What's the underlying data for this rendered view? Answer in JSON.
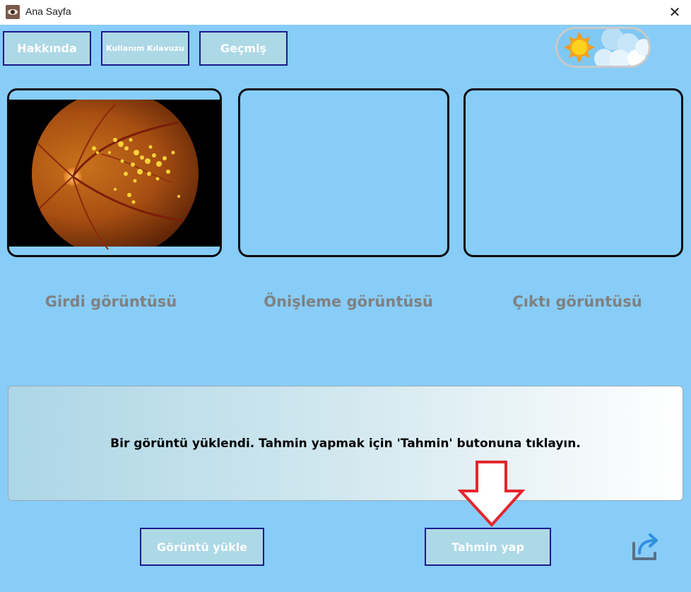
{
  "window": {
    "title": "Ana Sayfa",
    "close_glyph": "✕"
  },
  "toolbar": {
    "about_label": "Hakkında",
    "guide_label": "Kullanım Kılavuzu",
    "history_label": "Geçmiş"
  },
  "panels": {
    "input_label": "Girdi görüntüsü",
    "preprocess_label": "Önişleme görüntüsü",
    "output_label": "Çıktı görüntüsü"
  },
  "message": {
    "text": "Bir görüntü yüklendi. Tahmin yapmak için 'Tahmin' butonuna tıklayın."
  },
  "actions": {
    "upload_label": "Görüntü yükle",
    "predict_label": "Tahmin yap"
  },
  "icons": {
    "app": "eye-icon",
    "theme": "sun-cloud-icon",
    "share": "share-arrow-icon",
    "hint": "down-arrow-icon"
  },
  "colors": {
    "background": "#87cdf8",
    "button_fill": "#add8e6",
    "button_border": "#1a1a8c",
    "hint_arrow": "#e3262e",
    "label_gray": "#808080"
  }
}
